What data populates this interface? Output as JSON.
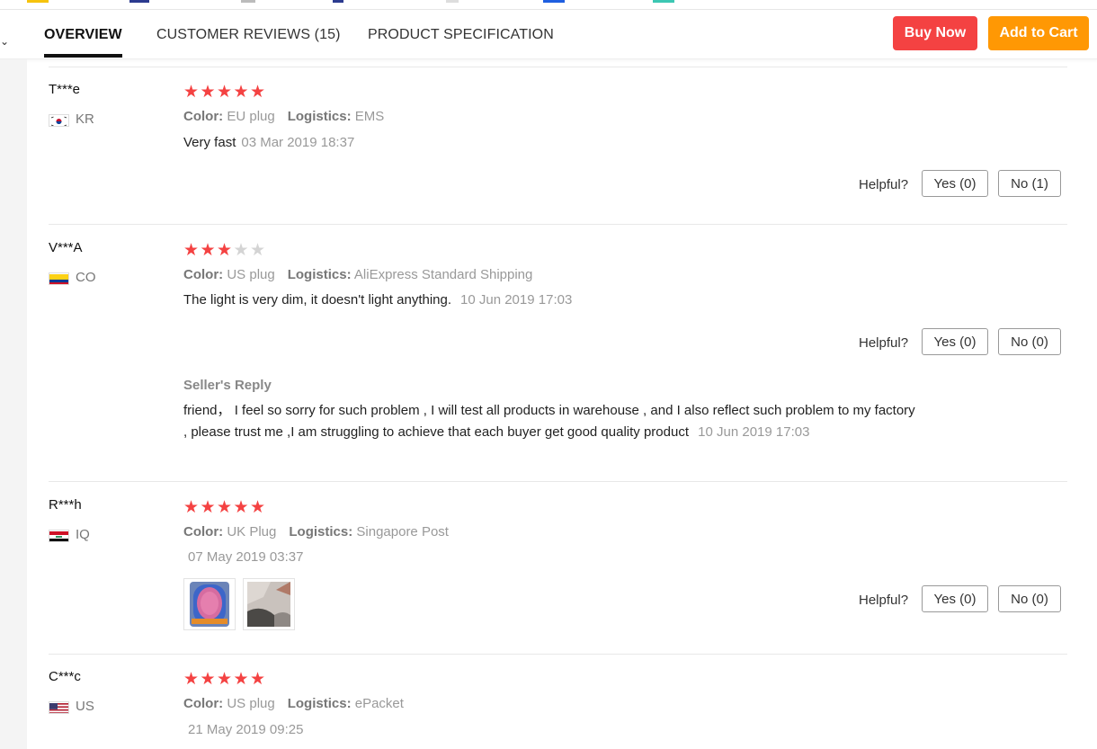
{
  "tabs": [
    "OVERVIEW",
    "CUSTOMER REVIEWS (15)",
    "PRODUCT SPECIFICATION"
  ],
  "buttons": {
    "buy_now": "Buy Now",
    "add_to_cart": "Add to Cart"
  },
  "colors": {
    "buy_now": "#f44242",
    "add_to_cart": "#ff9804",
    "star_on": "#f44242",
    "star_off": "#d4d4d4"
  },
  "labels": {
    "color": "Color:",
    "logistics": "Logistics:",
    "helpful": "Helpful?",
    "seller_reply": "Seller's Reply"
  },
  "reviews": [
    {
      "user": "T***e",
      "country": "KR",
      "rating": 5,
      "color": "EU plug",
      "logistics": "EMS",
      "text": "Very fast",
      "date": "03 Mar 2019 18:37",
      "yes": "Yes (0)",
      "no": "No (1)"
    },
    {
      "user": "V***A",
      "country": "CO",
      "rating": 3,
      "color": "US plug",
      "logistics": "AliExpress Standard Shipping",
      "text": "The light is very dim, it doesn't light anything.",
      "date": "10 Jun 2019 17:03",
      "yes": "Yes (0)",
      "no": "No (0)",
      "reply": {
        "text": "friend， I feel so sorry for such problem , I will test all products in warehouse , and I also reflect such problem to my factory , please trust me ,I am struggling to achieve that each buyer get good quality product",
        "date": "10 Jun 2019 17:03"
      }
    },
    {
      "user": "R***h",
      "country": "IQ",
      "rating": 5,
      "color": "UK Plug",
      "logistics": "Singapore Post",
      "text": "",
      "date": "07 May 2019 03:37",
      "yes": "Yes (0)",
      "no": "No (0)",
      "photos": [
        "photo-1",
        "photo-2"
      ]
    },
    {
      "user": "C***c",
      "country": "US",
      "rating": 5,
      "color": "US plug",
      "logistics": "ePacket",
      "text": "",
      "date": "21 May 2019 09:25"
    }
  ]
}
